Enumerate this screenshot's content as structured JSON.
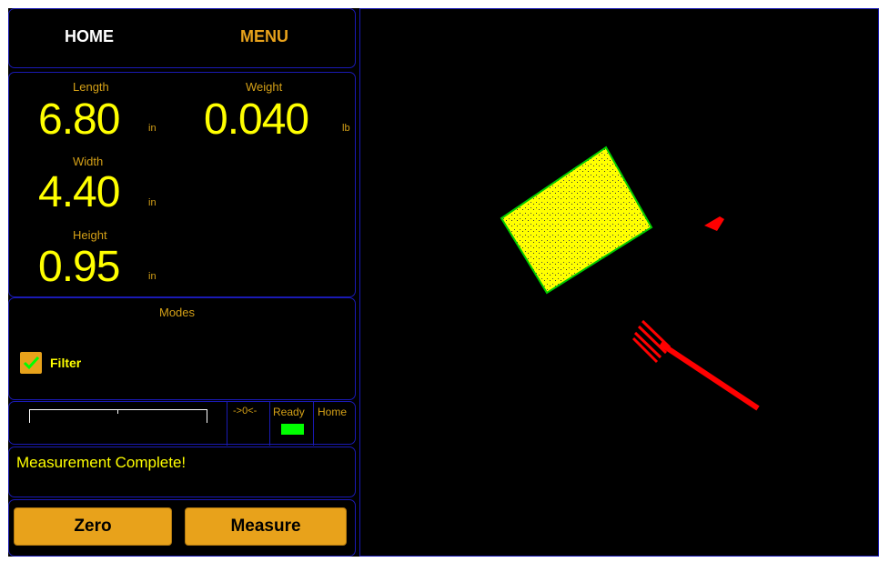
{
  "nav": {
    "home_label": "HOME",
    "menu_label": "MENU"
  },
  "measurements": {
    "length": {
      "label": "Length",
      "value": "6.80",
      "unit": "in"
    },
    "weight": {
      "label": "Weight",
      "value": "0.040",
      "unit": "lb"
    },
    "width": {
      "label": "Width",
      "value": "4.40",
      "unit": "in"
    },
    "height": {
      "label": "Height",
      "value": "0.95",
      "unit": "in"
    }
  },
  "modes": {
    "title": "Modes",
    "filter_label": "Filter",
    "filter_checked": true
  },
  "status": {
    "zero_label": "->0<-",
    "ready_label": "Ready",
    "home_label": "Home",
    "ready_color": "#00ff00"
  },
  "message": "Measurement Complete!",
  "buttons": {
    "zero_label": "Zero",
    "measure_label": "Measure"
  },
  "colors": {
    "accent": "#e8a21b",
    "value_yellow": "#ffff00",
    "border_blue": "#1a1ab4",
    "object_red": "#ff0000",
    "box_green": "#00cc00"
  }
}
